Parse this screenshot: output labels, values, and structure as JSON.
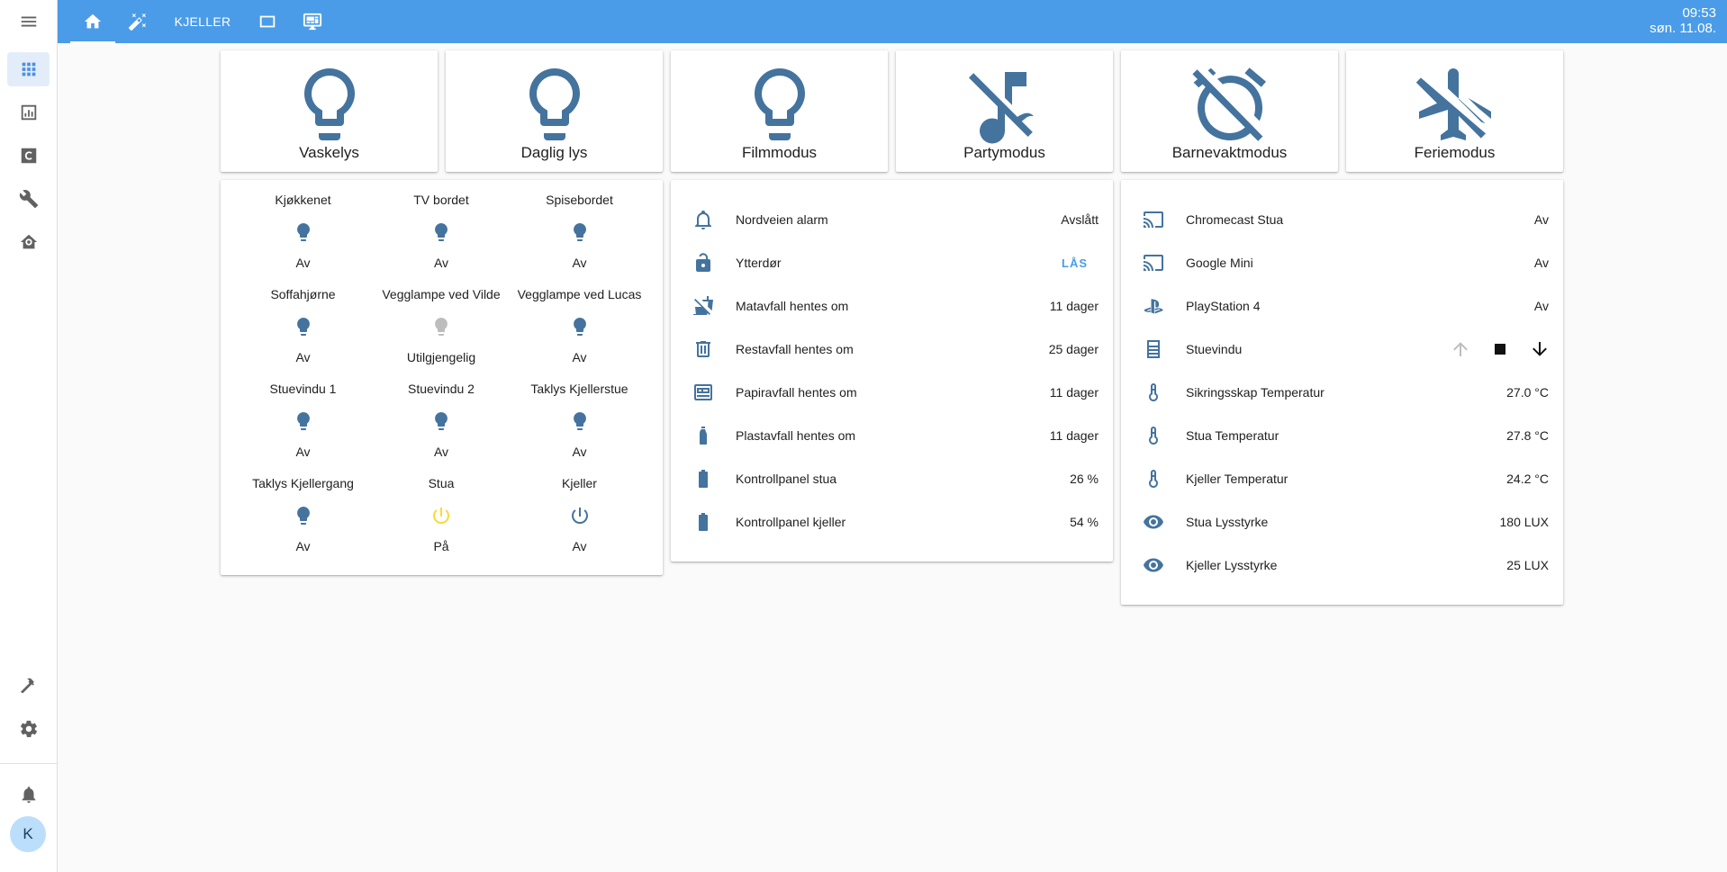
{
  "topbar": {
    "tabs": [
      {
        "icon": "home-icon",
        "active": true
      },
      {
        "icon": "magic-wand-icon"
      },
      {
        "label": "KJELLER"
      },
      {
        "icon": "rectangle-icon"
      },
      {
        "icon": "monitor-dashboard-icon"
      }
    ],
    "clock": {
      "time": "09:53",
      "date": "søn. 11.08."
    }
  },
  "sidebar": {
    "items": [
      {
        "icon": "menu-icon"
      },
      {
        "icon": "overview-grid-icon",
        "active": true
      },
      {
        "icon": "history-chart-icon"
      },
      {
        "icon": "hacs-icon"
      },
      {
        "icon": "wrench-icon"
      },
      {
        "icon": "home-automation-icon"
      },
      {
        "icon": "hammer-icon"
      },
      {
        "icon": "settings-icon"
      },
      {
        "icon": "bell-icon"
      }
    ],
    "avatar": "K"
  },
  "modes": [
    {
      "label": "Vaskelys",
      "icon": "lightbulb-icon"
    },
    {
      "label": "Daglig lys",
      "icon": "lightbulb-icon"
    },
    {
      "label": "Filmmodus",
      "icon": "lightbulb-icon"
    },
    {
      "label": "Partymodus",
      "icon": "music-off-icon"
    },
    {
      "label": "Barnevaktmodus",
      "icon": "alarm-off-icon"
    },
    {
      "label": "Feriemodus",
      "icon": "airplane-off-icon"
    }
  ],
  "glance": [
    {
      "name": "Kjøkkenet",
      "state": "Av",
      "icon": "bulb-icon"
    },
    {
      "name": "TV bordet",
      "state": "Av",
      "icon": "bulb-icon"
    },
    {
      "name": "Spisebordet",
      "state": "Av",
      "icon": "bulb-icon"
    },
    {
      "name": "Soffahjørne",
      "state": "Av",
      "icon": "bulb-icon"
    },
    {
      "name": "Vegglampe ved Vilde",
      "state": "Utilgjengelig",
      "icon": "bulb-icon"
    },
    {
      "name": "Vegglampe ved Lucas",
      "state": "Av",
      "icon": "bulb-icon"
    },
    {
      "name": "Stuevindu 1",
      "state": "Av",
      "icon": "bulb-icon"
    },
    {
      "name": "Stuevindu 2",
      "state": "Av",
      "icon": "bulb-icon"
    },
    {
      "name": "Taklys Kjellerstue",
      "state": "Av",
      "icon": "bulb-icon"
    },
    {
      "name": "Taklys Kjellergang",
      "state": "Av",
      "icon": "bulb-icon"
    },
    {
      "name": "Stua",
      "state": "På",
      "icon": "power-icon"
    },
    {
      "name": "Kjeller",
      "state": "Av",
      "icon": "power-icon"
    }
  ],
  "entities_mid": [
    {
      "name": "Nordveien alarm",
      "state": "Avslått",
      "icon": "bell-outline-icon"
    },
    {
      "name": "Ytterdør",
      "state": "LÅS",
      "icon": "lock-open-icon"
    },
    {
      "name": "Matavfall hentes om",
      "state": "11 dager",
      "icon": "food-off-icon"
    },
    {
      "name": "Restavfall hentes om",
      "state": "25 dager",
      "icon": "trash-can-icon"
    },
    {
      "name": "Papiravfall hentes om",
      "state": "11 dager",
      "icon": "newspaper-icon"
    },
    {
      "name": "Plastavfall hentes om",
      "state": "11 dager",
      "icon": "bottle-icon"
    },
    {
      "name": "Kontrollpanel stua",
      "state": "26 %",
      "icon": "battery-icon"
    },
    {
      "name": "Kontrollpanel kjeller",
      "state": "54 %",
      "icon": "battery-icon"
    }
  ],
  "entities_right": [
    {
      "name": "Chromecast Stua",
      "state": "Av",
      "icon": "cast-icon"
    },
    {
      "name": "Google Mini",
      "state": "Av",
      "icon": "cast-icon"
    },
    {
      "name": "PlayStation 4",
      "state": "Av",
      "icon": "playstation-icon"
    },
    {
      "name": "Stuevindu",
      "state": "",
      "icon": "window-shutter-icon"
    },
    {
      "name": "Sikringsskap Temperatur",
      "state": "27.0 °C",
      "icon": "thermometer-icon"
    },
    {
      "name": "Stua Temperatur",
      "state": "27.8 °C",
      "icon": "thermometer-icon"
    },
    {
      "name": "Kjeller Temperatur",
      "state": "24.2 °C",
      "icon": "thermometer-icon"
    },
    {
      "name": "Stua Lysstyrke",
      "state": "180 LUX",
      "icon": "eye-icon"
    },
    {
      "name": "Kjeller Lysstyrke",
      "state": "25 LUX",
      "icon": "eye-icon"
    }
  ],
  "colors": {
    "header": "#4a9ce8",
    "icon": "#44739e",
    "on": "#fdd835",
    "accent": "#4a9ce8"
  }
}
